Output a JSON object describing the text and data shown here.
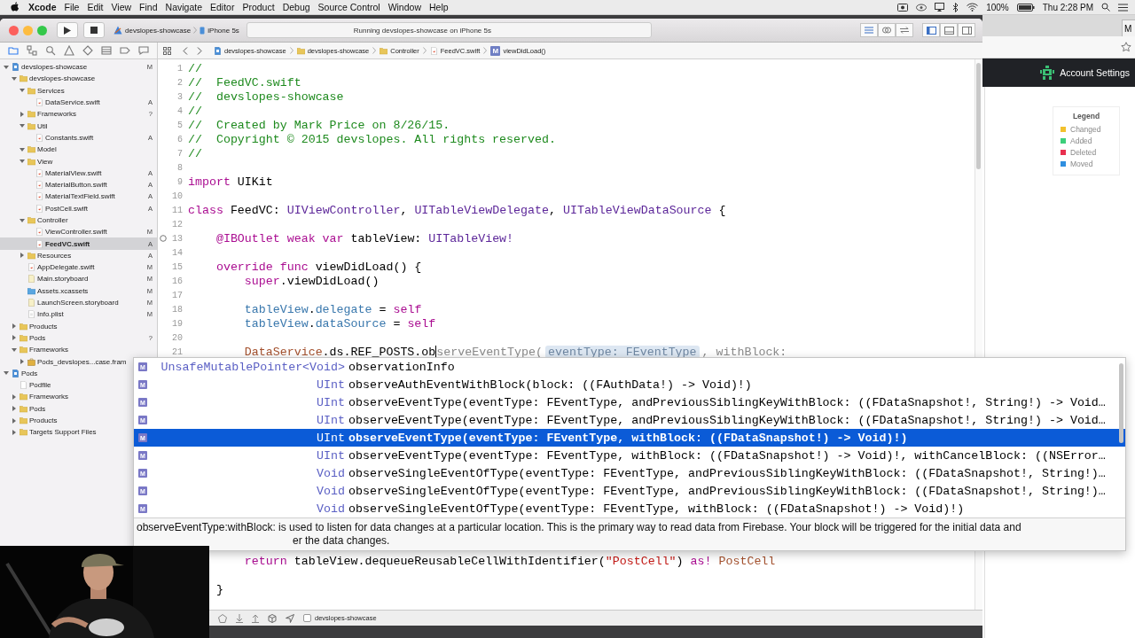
{
  "menubar": {
    "app": "Xcode",
    "menus": [
      "File",
      "Edit",
      "View",
      "Find",
      "Navigate",
      "Editor",
      "Product",
      "Debug",
      "Source Control",
      "Window",
      "Help"
    ],
    "battery": "100%",
    "clock": "Thu 2:28 PM"
  },
  "toolbar": {
    "lights": [
      {
        "color": "#fc605c"
      },
      {
        "color": "#fdbc40"
      },
      {
        "color": "#34c84a"
      }
    ],
    "scheme": "devslopes-showcase",
    "device": "iPhone 5s",
    "status": "Running devslopes-showcase on iPhone 5s"
  },
  "navigator": {
    "tabs": [
      {
        "kind": "folder",
        "selected": true
      },
      {
        "kind": "hierarchy",
        "selected": false
      },
      {
        "kind": "search",
        "selected": false
      },
      {
        "kind": "warning",
        "selected": false
      },
      {
        "kind": "test",
        "selected": false
      },
      {
        "kind": "debug",
        "selected": false
      },
      {
        "kind": "breakpoint",
        "selected": false
      },
      {
        "kind": "report",
        "selected": false
      }
    ],
    "tree": [
      {
        "label": "devslopes-showcase",
        "kind": "project",
        "badge": "M",
        "expanded": true,
        "selected": false,
        "children": [
          {
            "label": "devslopes-showcase",
            "kind": "folder",
            "expanded": true,
            "selected": false,
            "children": [
              {
                "label": "Services",
                "kind": "folder",
                "expanded": true,
                "selected": false,
                "children": [
                  {
                    "label": "DataService.swift",
                    "kind": "swift",
                    "badge": "A",
                    "selected": false
                  }
                ]
              },
              {
                "label": "Frameworks",
                "kind": "folder",
                "badge": "?",
                "expanded": false,
                "selected": false
              },
              {
                "label": "Util",
                "kind": "folder",
                "expanded": true,
                "selected": false,
                "children": [
                  {
                    "label": "Constants.swift",
                    "kind": "swift",
                    "badge": "A",
                    "selected": false
                  }
                ]
              },
              {
                "label": "Model",
                "kind": "folder",
                "expanded": true,
                "selected": false
              },
              {
                "label": "View",
                "kind": "folder",
                "expanded": true,
                "selected": false,
                "children": [
                  {
                    "label": "MaterialView.swift",
                    "kind": "swift",
                    "badge": "A",
                    "selected": false
                  },
                  {
                    "label": "MaterialButton.swift",
                    "kind": "swift",
                    "badge": "A",
                    "selected": false
                  },
                  {
                    "label": "MaterialTextField.swift",
                    "kind": "swift",
                    "badge": "A",
                    "selected": false
                  },
                  {
                    "label": "PostCell.swift",
                    "kind": "swift",
                    "badge": "A",
                    "selected": false
                  }
                ]
              },
              {
                "label": "Controller",
                "kind": "folder",
                "expanded": true,
                "selected": false,
                "children": [
                  {
                    "label": "ViewController.swift",
                    "kind": "swift",
                    "badge": "M",
                    "selected": false
                  },
                  {
                    "label": "FeedVC.swift",
                    "kind": "swift",
                    "badge": "A",
                    "selected": true
                  }
                ]
              },
              {
                "label": "Resources",
                "kind": "folder",
                "badge": "A",
                "expanded": false,
                "selected": false
              },
              {
                "label": "AppDelegate.swift",
                "kind": "swift",
                "badge": "M",
                "selected": false
              },
              {
                "label": "Main.storyboard",
                "kind": "storyboard",
                "badge": "M",
                "selected": false
              },
              {
                "label": "Assets.xcassets",
                "kind": "assets",
                "badge": "M",
                "selected": false
              },
              {
                "label": "LaunchScreen.storyboard",
                "kind": "storyboard",
                "badge": "M",
                "selected": false
              },
              {
                "label": "Info.plist",
                "kind": "plist",
                "badge": "M",
                "selected": false
              }
            ]
          },
          {
            "label": "Products",
            "kind": "folder",
            "expanded": false,
            "selected": false
          },
          {
            "label": "Pods",
            "kind": "folder",
            "badge": "?",
            "expanded": false,
            "selected": false
          },
          {
            "label": "Frameworks",
            "kind": "folder",
            "expanded": true,
            "selected": false,
            "children": [
              {
                "label": "Pods_devslopes...case.fram",
                "kind": "framework",
                "expanded": false,
                "selected": false
              }
            ]
          }
        ]
      },
      {
        "label": "Pods",
        "kind": "project",
        "expanded": true,
        "selected": false,
        "children": [
          {
            "label": "Podfile",
            "kind": "file",
            "selected": false
          },
          {
            "label": "Frameworks",
            "kind": "folder",
            "expanded": false,
            "selected": false
          },
          {
            "label": "Pods",
            "kind": "folder",
            "expanded": false,
            "selected": false
          },
          {
            "label": "Products",
            "kind": "folder",
            "expanded": false,
            "selected": false
          },
          {
            "label": "Targets Support Files",
            "kind": "folder",
            "expanded": false,
            "selected": false
          }
        ]
      }
    ]
  },
  "jump_bar": {
    "crumbs": [
      {
        "label": "devslopes-showcase",
        "kind": "project"
      },
      {
        "label": "devslopes-showcase",
        "kind": "folder"
      },
      {
        "label": "Controller",
        "kind": "folder"
      },
      {
        "label": "FeedVC.swift",
        "kind": "swift"
      },
      {
        "label": "viewDidLoad()",
        "kind": "method",
        "badge": "M"
      }
    ]
  },
  "editor": {
    "lines": [
      {
        "number": "1",
        "tokens": [
          {
            "kind": "comment",
            "text": "//"
          }
        ]
      },
      {
        "number": "2",
        "tokens": [
          {
            "kind": "comment",
            "text": "//  FeedVC.swift"
          }
        ]
      },
      {
        "number": "3",
        "tokens": [
          {
            "kind": "comment",
            "text": "//  devslopes-showcase"
          }
        ]
      },
      {
        "number": "4",
        "tokens": [
          {
            "kind": "comment",
            "text": "//"
          }
        ]
      },
      {
        "number": "5",
        "tokens": [
          {
            "kind": "comment",
            "text": "//  Created by Mark Price on 8/26/15."
          }
        ]
      },
      {
        "number": "6",
        "tokens": [
          {
            "kind": "comment",
            "text": "//  Copyright © 2015 devslopes. All rights reserved."
          }
        ]
      },
      {
        "number": "7",
        "tokens": [
          {
            "kind": "comment",
            "text": "//"
          }
        ]
      },
      {
        "number": "8"
      },
      {
        "number": "9",
        "tokens": [
          {
            "kind": "keyword",
            "text": "import"
          },
          {
            "kind": "plain",
            "text": " UIKit"
          }
        ]
      },
      {
        "number": "10"
      },
      {
        "number": "11",
        "tokens": [
          {
            "kind": "keyword",
            "text": "class"
          },
          {
            "kind": "plain",
            "text": " FeedVC: "
          },
          {
            "kind": "type",
            "text": "UIViewController"
          },
          {
            "kind": "plain",
            "text": ", "
          },
          {
            "kind": "type",
            "text": "UITableViewDelegate"
          },
          {
            "kind": "plain",
            "text": ", "
          },
          {
            "kind": "type",
            "text": "UITableViewDataSource"
          },
          {
            "kind": "plain",
            "text": " {"
          }
        ]
      },
      {
        "number": "12"
      },
      {
        "number": "13",
        "outlet": {
          "connected": false
        },
        "tokens": [
          {
            "kind": "keyword",
            "text": "    @IBOutlet weak var"
          },
          {
            "kind": "plain",
            "text": " tableView: "
          },
          {
            "kind": "type",
            "text": "UITableView!"
          }
        ]
      },
      {
        "number": "14"
      },
      {
        "number": "15",
        "tokens": [
          {
            "kind": "keyword",
            "text": "    override func"
          },
          {
            "kind": "plain",
            "text": " viewDidLoad() {"
          }
        ]
      },
      {
        "number": "16",
        "tokens": [
          {
            "kind": "keyword",
            "text": "        super"
          },
          {
            "kind": "plain",
            "text": ".viewDidLoad()"
          }
        ]
      },
      {
        "number": "17"
      },
      {
        "number": "18",
        "tokens": [
          {
            "kind": "member",
            "text": "        tableView"
          },
          {
            "kind": "plain",
            "text": "."
          },
          {
            "kind": "member",
            "text": "delegate"
          },
          {
            "kind": "plain",
            "text": " = "
          },
          {
            "kind": "keyword",
            "text": "self"
          }
        ]
      },
      {
        "number": "19",
        "tokens": [
          {
            "kind": "member",
            "text": "        tableView"
          },
          {
            "kind": "plain",
            "text": "."
          },
          {
            "kind": "member",
            "text": "dataSource"
          },
          {
            "kind": "plain",
            "text": " = "
          },
          {
            "kind": "keyword",
            "text": "self"
          }
        ]
      },
      {
        "number": "20"
      },
      {
        "number": "21",
        "tokens": [
          {
            "kind": "project",
            "text": "        DataService"
          },
          {
            "kind": "plain",
            "text": ".ds.REF_POSTS.ob"
          },
          {
            "kind": "cursor"
          },
          {
            "kind": "ghost",
            "text": "serveEventType("
          },
          {
            "kind": "placeholder",
            "text": "eventType: FEventType"
          },
          {
            "kind": "ghost",
            "text": ", withBlock:"
          }
        ]
      }
    ],
    "lower_lines": [
      {
        "tokens": [
          {
            "kind": "keyword",
            "text": "        return"
          },
          {
            "kind": "plain",
            "text": " tableView.dequeueReusableCellWithIdentifier("
          },
          {
            "kind": "string",
            "text": "\"PostCell\""
          },
          {
            "kind": "plain",
            "text": ") "
          },
          {
            "kind": "keyword",
            "text": "as!"
          },
          {
            "kind": "project",
            "text": " PostCell"
          }
        ]
      },
      {
        "tokens": [
          {
            "kind": "plain",
            "text": "    }"
          }
        ]
      }
    ]
  },
  "completion": {
    "rows": [
      {
        "badge": "M",
        "return_type": "UnsafeMutablePointer<Void>",
        "signature": "observationInfo",
        "selected": false
      },
      {
        "badge": "M",
        "return_type": "UInt",
        "signature": "observeAuthEventWithBlock(block: ((FAuthData!) -> Void)!)",
        "selected": false
      },
      {
        "badge": "M",
        "return_type": "UInt",
        "signature": "observeEventType(eventType: FEventType, andPreviousSiblingKeyWithBlock: ((FDataSnapshot!, String!) -> Void…",
        "selected": false
      },
      {
        "badge": "M",
        "return_type": "UInt",
        "signature": "observeEventType(eventType: FEventType, andPreviousSiblingKeyWithBlock: ((FDataSnapshot!, String!) -> Void…",
        "selected": false
      },
      {
        "badge": "M",
        "return_type": "UInt",
        "signature": "observeEventType(eventType: FEventType, withBlock: ((FDataSnapshot!) -> Void)!)",
        "selected": true
      },
      {
        "badge": "M",
        "return_type": "UInt",
        "signature": "observeEventType(eventType: FEventType, withBlock: ((FDataSnapshot!) -> Void)!, withCancelBlock: ((NSError…",
        "selected": false
      },
      {
        "badge": "M",
        "return_type": "Void",
        "signature": "observeSingleEventOfType(eventType: FEventType, andPreviousSiblingKeyWithBlock: ((FDataSnapshot!, String!)…",
        "selected": false
      },
      {
        "badge": "M",
        "return_type": "Void",
        "signature": "observeSingleEventOfType(eventType: FEventType, andPreviousSiblingKeyWithBlock: ((FDataSnapshot!, String!)…",
        "selected": false
      },
      {
        "badge": "M",
        "return_type": "Void",
        "signature": "observeSingleEventOfType(eventType: FEventType, withBlock: ((FDataSnapshot!) -> Void)!)",
        "selected": false
      }
    ],
    "doc": [
      "observeEventType:withBlock: is used to listen for data changes at a particular location. This is the primary way to read data from Firebase. Your block will be triggered for the initial data and",
      "er the data changes."
    ]
  },
  "debug_bar": {
    "target": "devslopes-showcase"
  },
  "browser": {
    "tab": "M",
    "header": "Account Settings",
    "legend": {
      "title": "Legend",
      "items": [
        {
          "label": "Changed",
          "color": "#f2c12e"
        },
        {
          "label": "Added",
          "color": "#3ccf7a"
        },
        {
          "label": "Deleted",
          "color": "#e8304f"
        },
        {
          "label": "Moved",
          "color": "#2f8fe0"
        }
      ]
    }
  }
}
